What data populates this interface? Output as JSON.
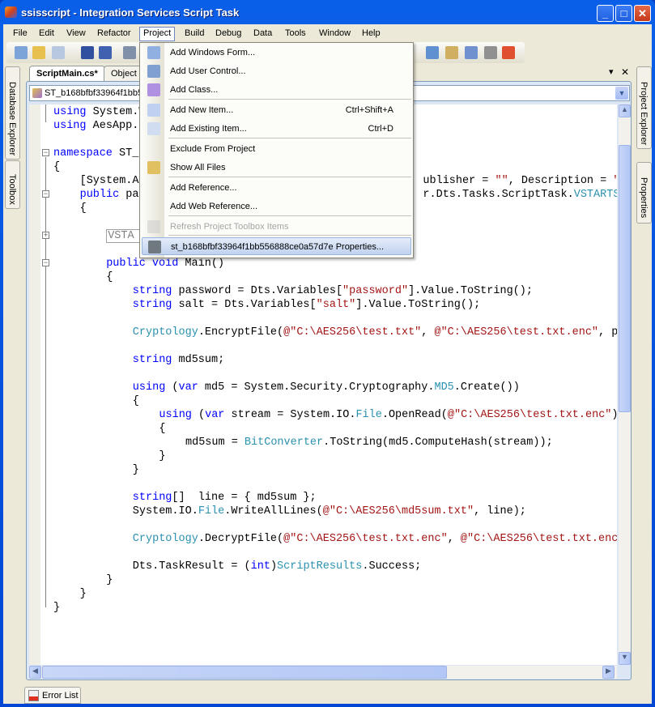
{
  "window": {
    "title": "ssisscript - Integration Services Script Task",
    "minimize": "_",
    "maximize": "□",
    "close": "✕"
  },
  "menubar": {
    "items": [
      "File",
      "Edit",
      "View",
      "Refactor",
      "Project",
      "Build",
      "Debug",
      "Data",
      "Tools",
      "Window",
      "Help"
    ],
    "active": "Project"
  },
  "left_panels": [
    "Database Explorer",
    "Toolbox"
  ],
  "right_panels": [
    "Project Explorer",
    "Properties"
  ],
  "tabs": [
    {
      "label": "ScriptMain.cs*",
      "active": true
    },
    {
      "label": "Object"
    }
  ],
  "tab_controls": {
    "dropdown": "▾",
    "close": "✕"
  },
  "type_combo": {
    "value": "ST_b168bfbf33964f1bb5"
  },
  "project_menu": {
    "items": [
      {
        "label": "Add Windows Form...",
        "icon": "windows-form-icon"
      },
      {
        "label": "Add User Control...",
        "icon": "user-control-icon"
      },
      {
        "label": "Add Class...",
        "icon": "class-icon"
      },
      {
        "label": "Add New Item...",
        "shortcut": "Ctrl+Shift+A",
        "icon": "new-item-icon"
      },
      {
        "label": "Add Existing Item...",
        "shortcut": "Ctrl+D",
        "icon": "existing-item-icon"
      },
      {
        "label": "Exclude From Project"
      },
      {
        "label": "Show All Files",
        "icon": "show-all-files-icon"
      },
      {
        "label": "Add Reference..."
      },
      {
        "label": "Add Web Reference..."
      },
      {
        "label": "Refresh Project Toolbox Items",
        "disabled": true,
        "icon": "refresh-icon"
      },
      {
        "label": "st_b168bfbf33964f1bb556888ce0a57d7e Properties...",
        "highlighted": true,
        "icon": "properties-icon"
      }
    ]
  },
  "code": {
    "lines": [
      {
        "row": 0,
        "indent": 0,
        "tokens": [
          [
            "using",
            "kw"
          ],
          [
            " System.W",
            ""
          ]
        ]
      },
      {
        "row": 1,
        "indent": 0,
        "tokens": [
          [
            "using",
            "kw"
          ],
          [
            " AesApp.P",
            ""
          ]
        ]
      },
      {
        "row": 3,
        "indent": 0,
        "tokens": [
          [
            "namespace",
            "kw"
          ],
          [
            " ST_b",
            ""
          ]
        ]
      },
      {
        "row": 4,
        "indent": 0,
        "tokens": [
          [
            "{",
            ""
          ]
        ]
      },
      {
        "row": 5,
        "indent": 4,
        "tokens": [
          [
            "[System.Ac",
            ""
          ]
        ]
      },
      {
        "row": 5,
        "col": 56,
        "tokens": [
          [
            "ublisher = ",
            ""
          ],
          [
            "\"\"",
            "str"
          ],
          [
            ", Description = ",
            ""
          ],
          [
            "\"\"",
            "str"
          ]
        ]
      },
      {
        "row": 6,
        "indent": 4,
        "tokens": [
          [
            "public",
            "kw"
          ],
          [
            " par",
            ""
          ]
        ]
      },
      {
        "row": 6,
        "col": 56,
        "tokens": [
          [
            "r.Dts.Tasks.ScriptTask.",
            ""
          ],
          [
            "VSTARTSc",
            "typ"
          ]
        ]
      },
      {
        "row": 7,
        "indent": 4,
        "tokens": [
          [
            "{",
            ""
          ]
        ]
      },
      {
        "row": 9,
        "indent": 8,
        "tokens": [
          [
            "VSTA g",
            "box"
          ]
        ]
      },
      {
        "row": 11,
        "indent": 8,
        "tokens": [
          [
            "public",
            "kw"
          ],
          [
            " ",
            ""
          ],
          [
            "void",
            "kw"
          ],
          [
            " Main()",
            ""
          ]
        ]
      },
      {
        "row": 12,
        "indent": 8,
        "tokens": [
          [
            "{",
            ""
          ]
        ]
      },
      {
        "row": 13,
        "indent": 12,
        "tokens": [
          [
            "string",
            "kw"
          ],
          [
            " password = Dts.Variables[",
            ""
          ],
          [
            "\"password\"",
            "str"
          ],
          [
            "].Value.ToString();",
            ""
          ]
        ]
      },
      {
        "row": 14,
        "indent": 12,
        "tokens": [
          [
            "string",
            "kw"
          ],
          [
            " salt = Dts.Variables[",
            ""
          ],
          [
            "\"salt\"",
            "str"
          ],
          [
            "].Value.ToString();",
            ""
          ]
        ]
      },
      {
        "row": 16,
        "indent": 12,
        "tokens": [
          [
            "Cryptology",
            "typ"
          ],
          [
            ".EncryptFile(",
            ""
          ],
          [
            "@\"C:\\AES256\\test.txt\"",
            "str"
          ],
          [
            ", ",
            ""
          ],
          [
            "@\"C:\\AES256\\test.txt.enc\"",
            "str"
          ],
          [
            ", pa",
            ""
          ]
        ]
      },
      {
        "row": 18,
        "indent": 12,
        "tokens": [
          [
            "string",
            "kw"
          ],
          [
            " md5sum;",
            ""
          ]
        ]
      },
      {
        "row": 20,
        "indent": 12,
        "tokens": [
          [
            "using",
            "kw"
          ],
          [
            " (",
            ""
          ],
          [
            "var",
            "kw"
          ],
          [
            " md5 = System.Security.Cryptography.",
            ""
          ],
          [
            "MD5",
            "typ"
          ],
          [
            ".Create())",
            ""
          ]
        ]
      },
      {
        "row": 21,
        "indent": 12,
        "tokens": [
          [
            "{",
            ""
          ]
        ]
      },
      {
        "row": 22,
        "indent": 16,
        "tokens": [
          [
            "using",
            "kw"
          ],
          [
            " (",
            ""
          ],
          [
            "var",
            "kw"
          ],
          [
            " stream = System.IO.",
            ""
          ],
          [
            "File",
            "typ"
          ],
          [
            ".OpenRead(",
            ""
          ],
          [
            "@\"C:\\AES256\\test.txt.enc\"",
            "str"
          ],
          [
            "))",
            ""
          ]
        ]
      },
      {
        "row": 23,
        "indent": 16,
        "tokens": [
          [
            "{",
            ""
          ]
        ]
      },
      {
        "row": 24,
        "indent": 20,
        "tokens": [
          [
            "md5sum = ",
            ""
          ],
          [
            "BitConverter",
            "typ"
          ],
          [
            ".ToString(md5.ComputeHash(stream));",
            ""
          ]
        ]
      },
      {
        "row": 25,
        "indent": 16,
        "tokens": [
          [
            "}",
            ""
          ]
        ]
      },
      {
        "row": 26,
        "indent": 12,
        "tokens": [
          [
            "}",
            ""
          ]
        ]
      },
      {
        "row": 28,
        "indent": 12,
        "tokens": [
          [
            "string",
            "kw"
          ],
          [
            "[]  line = { md5sum };",
            ""
          ]
        ]
      },
      {
        "row": 29,
        "indent": 12,
        "tokens": [
          [
            "System.IO.",
            ""
          ],
          [
            "File",
            "typ"
          ],
          [
            ".WriteAllLines(",
            ""
          ],
          [
            "@\"C:\\AES256\\md5sum.txt\"",
            "str"
          ],
          [
            ", line);",
            ""
          ]
        ]
      },
      {
        "row": 31,
        "indent": 12,
        "tokens": [
          [
            "Cryptology",
            "typ"
          ],
          [
            ".DecryptFile(",
            ""
          ],
          [
            "@\"C:\\AES256\\test.txt.enc\"",
            "str"
          ],
          [
            ", ",
            ""
          ],
          [
            "@\"C:\\AES256\\test.txt.enc.",
            "str"
          ]
        ]
      },
      {
        "row": 33,
        "indent": 12,
        "tokens": [
          [
            "Dts.TaskResult = (",
            ""
          ],
          [
            "int",
            "kw"
          ],
          [
            ")",
            ""
          ],
          [
            "ScriptResults",
            "typ"
          ],
          [
            ".Success;",
            ""
          ]
        ]
      },
      {
        "row": 34,
        "indent": 8,
        "tokens": [
          [
            "}",
            ""
          ]
        ]
      },
      {
        "row": 35,
        "indent": 4,
        "tokens": [
          [
            "}",
            ""
          ]
        ]
      },
      {
        "row": 36,
        "indent": 0,
        "tokens": [
          [
            "}",
            ""
          ]
        ]
      }
    ]
  },
  "bottom_tabs": [
    "Error List"
  ],
  "colors": {
    "keyword": "#0000ff",
    "string": "#a31515",
    "type": "#2b91af",
    "titlebar": "#0a5fe8"
  }
}
